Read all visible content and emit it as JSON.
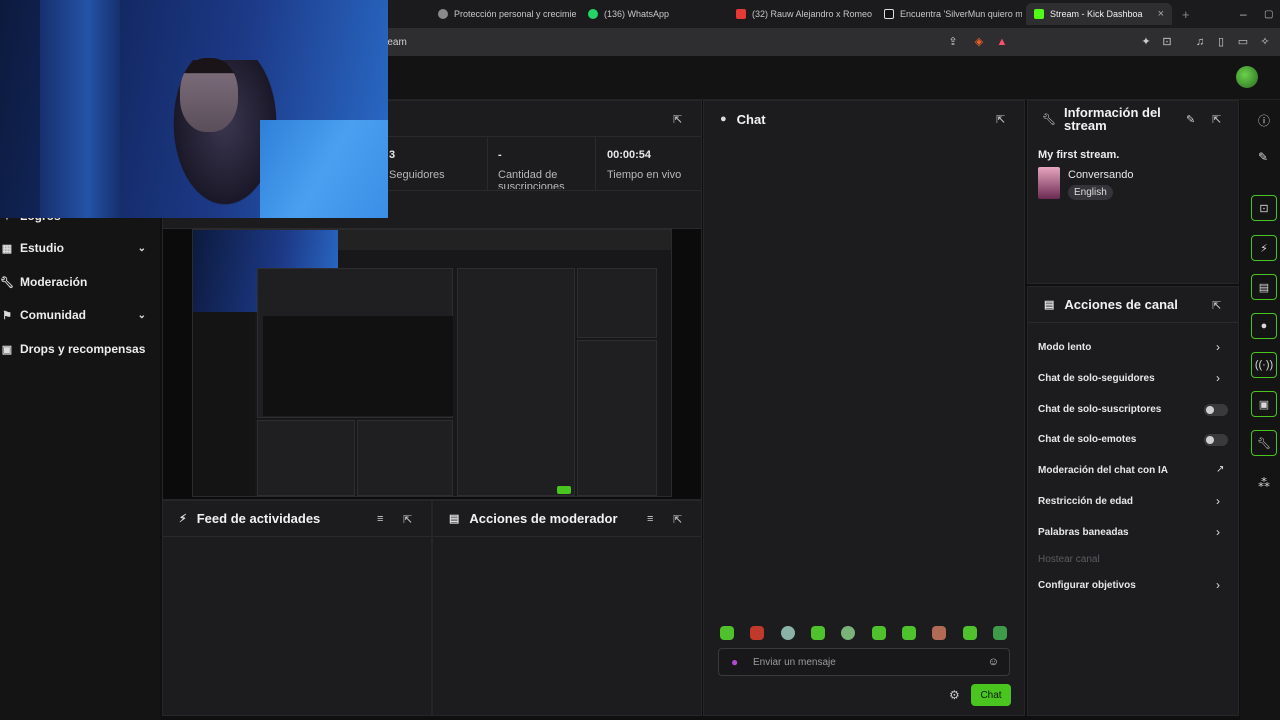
{
  "browser": {
    "tabs": [
      {
        "label": "Protección personal y crecimie",
        "color": "#9a9a9a"
      },
      {
        "label": "(136) WhatsApp",
        "color": "#25d366"
      },
      {
        "label": "(32) Rauw Alejandro x Romeo",
        "color": "#e53935"
      },
      {
        "label": "Encuentra 'SilverMun quiero m",
        "color": "#e0e0e0"
      },
      {
        "label": "Stream - Kick Dashboa",
        "color": "#53fc18"
      }
    ],
    "url": "ream"
  },
  "sidebar": {
    "items": [
      {
        "label": "Logros",
        "icon": "trophy-icon"
      },
      {
        "label": "Estudio",
        "icon": "studio-icon",
        "chevron": "⌄"
      },
      {
        "label": "Moderación",
        "icon": "wrench-icon"
      },
      {
        "label": "Comunidad",
        "icon": "community-icon",
        "chevron": "⌄"
      },
      {
        "label": "Drops y recompensas",
        "icon": "gift-icon"
      }
    ]
  },
  "stats": {
    "followers_value": "3",
    "followers_label": "Seguidores",
    "subs_value": "-",
    "subs_label": "Cantidad de suscripciones",
    "live_value": "00:00:54",
    "live_label": "Tiempo en vivo"
  },
  "feed": {
    "title": "Feed de actividades"
  },
  "mod": {
    "title": "Acciones de moderador"
  },
  "chat": {
    "title": "Chat",
    "placeholder": "Enviar un mensaje",
    "send_label": "Chat"
  },
  "stream_info": {
    "title": "Información del stream",
    "stream_title": "My first stream.",
    "category": "Conversando",
    "language": "English"
  },
  "channel_actions": {
    "title": "Acciones de canal",
    "items": [
      {
        "label": "Modo lento",
        "control": "chevron"
      },
      {
        "label": "Chat de solo-seguidores",
        "control": "chevron"
      },
      {
        "label": "Chat de solo-suscriptores",
        "control": "toggle"
      },
      {
        "label": "Chat de solo-emotes",
        "control": "toggle"
      },
      {
        "label": "Moderación del chat con IA",
        "control": "external"
      },
      {
        "label": "Restricción de edad",
        "control": "chevron"
      },
      {
        "label": "Palabras baneadas",
        "control": "chevron"
      },
      {
        "label": "Hostear canal",
        "control": "disabled"
      },
      {
        "label": "Configurar objetivos",
        "control": "chevron"
      }
    ]
  },
  "colors": {
    "accent": "#4ac41f",
    "panel": "#1c1c1e",
    "background": "#0f0f10"
  }
}
